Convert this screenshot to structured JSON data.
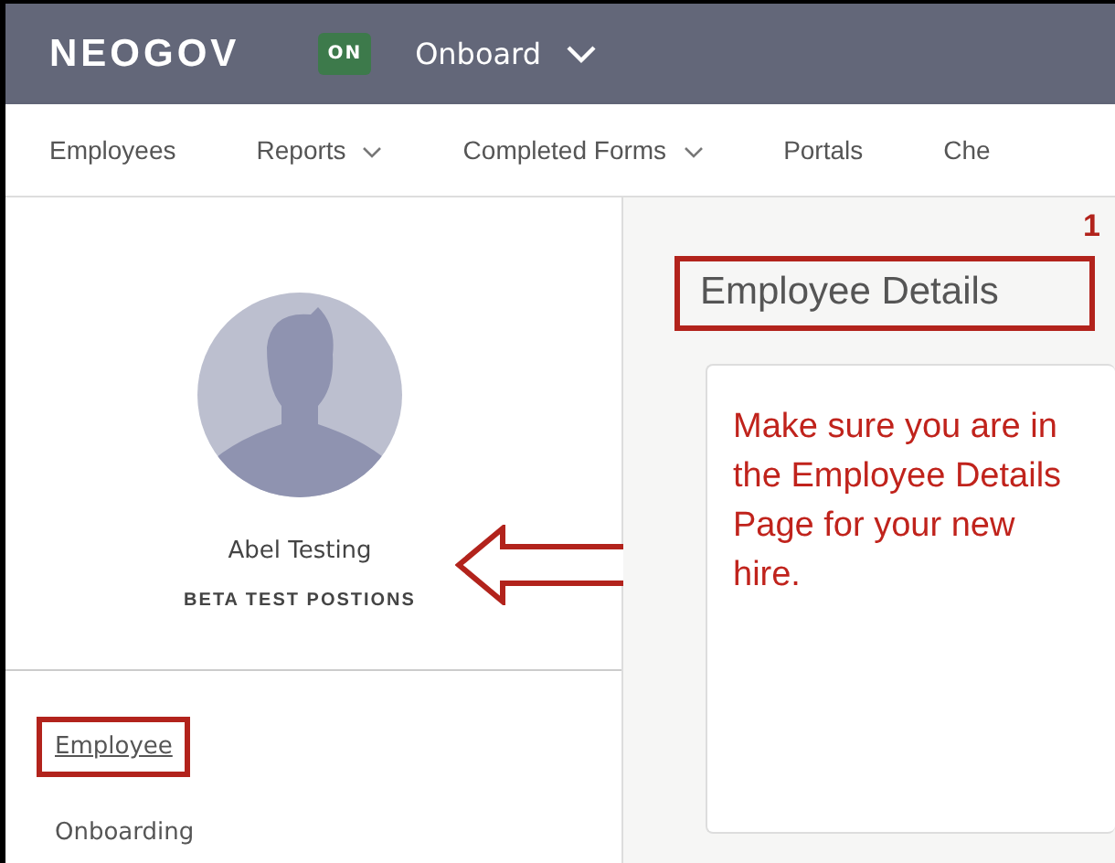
{
  "header": {
    "logo": "NEOGOV",
    "product_badge": "ON",
    "product": "Onboard"
  },
  "nav": [
    {
      "label": "Employees",
      "has_menu": false
    },
    {
      "label": "Reports",
      "has_menu": true
    },
    {
      "label": "Completed Forms",
      "has_menu": true
    },
    {
      "label": "Portals",
      "has_menu": false
    },
    {
      "label": "Che",
      "has_menu": false
    }
  ],
  "profile": {
    "name": "Abel Testing",
    "position": "BETA TEST POSTIONS"
  },
  "sidebar": {
    "items": [
      {
        "label": "Employee",
        "selected": true
      },
      {
        "label": "Onboarding",
        "selected": false
      }
    ]
  },
  "main": {
    "title": "Employee Details"
  },
  "annotations": {
    "step": "1",
    "note": "Make sure you are in the Employee Details Page for your new hire."
  }
}
